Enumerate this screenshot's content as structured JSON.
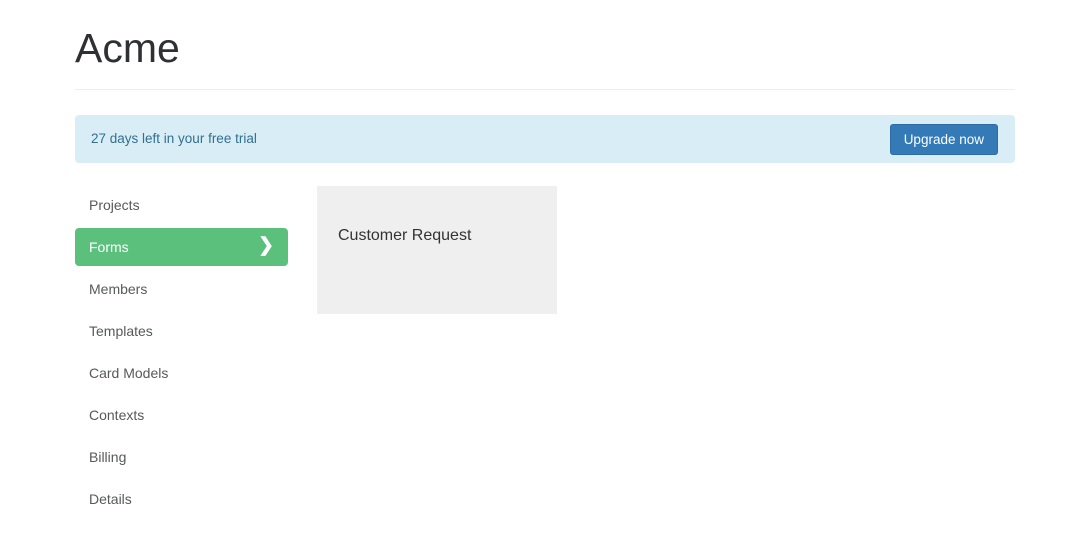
{
  "header": {
    "title": "Acme"
  },
  "trial_banner": {
    "message": "27 days left in your free trial",
    "upgrade_label": "Upgrade now",
    "background_color": "#d9edf7",
    "text_color": "#31708f",
    "button_color": "#337ab7"
  },
  "sidebar": {
    "active_color": "#5cc07d",
    "chevron_icon": "❯",
    "items": [
      {
        "label": "Projects",
        "active": false
      },
      {
        "label": "Forms",
        "active": true
      },
      {
        "label": "Members",
        "active": false
      },
      {
        "label": "Templates",
        "active": false
      },
      {
        "label": "Card Models",
        "active": false
      },
      {
        "label": "Contexts",
        "active": false
      },
      {
        "label": "Billing",
        "active": false
      },
      {
        "label": "Details",
        "active": false
      }
    ]
  },
  "main": {
    "cards": [
      {
        "title": "Customer Request"
      }
    ]
  }
}
